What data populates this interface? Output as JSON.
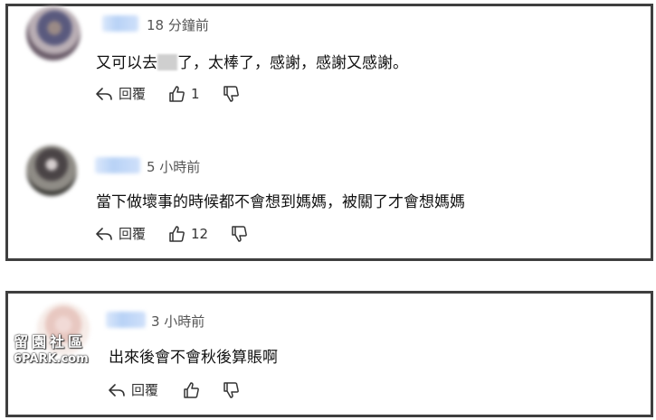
{
  "comments": [
    {
      "time": "18 分鐘前",
      "text_before": "又可以去",
      "text_after": "了，太棒了，感謝，感謝又感謝。",
      "reply_label": "回覆",
      "likes": "1"
    },
    {
      "time": "5 小時前",
      "text": "當下做壞事的時候都不會想到媽媽，被關了才會想媽媽",
      "reply_label": "回覆",
      "likes": "12"
    },
    {
      "time": "3 小時前",
      "text": "出來後會不會秋後算賬啊",
      "reply_label": "回覆",
      "likes": ""
    }
  ],
  "watermark": {
    "line1": "留園社區",
    "line2": "6PARK.com"
  },
  "icons": {
    "reply": "reply-icon",
    "like": "thumbs-up-icon",
    "dislike": "thumbs-down-icon"
  }
}
